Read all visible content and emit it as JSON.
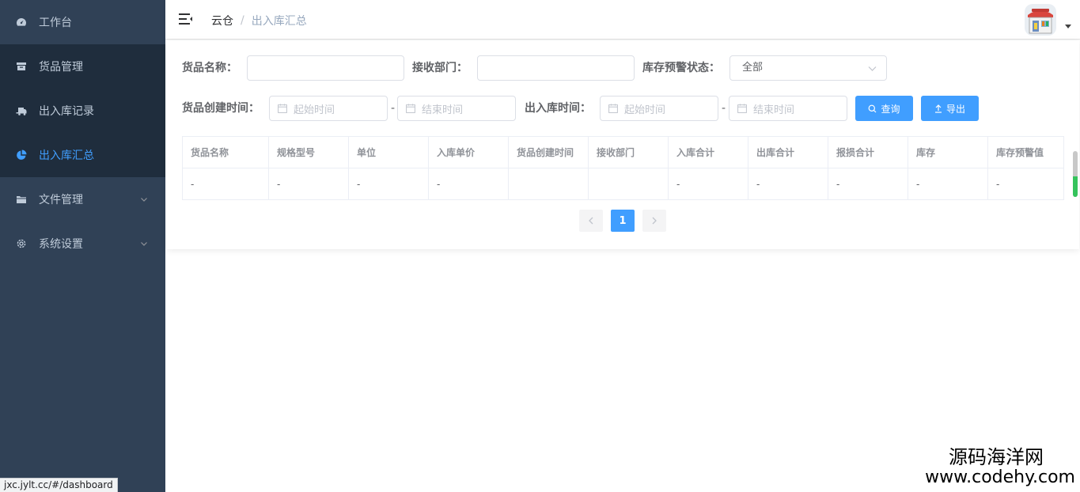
{
  "sidebar": {
    "items": [
      {
        "label": "工作台",
        "icon": "dashboard-icon"
      },
      {
        "label": "货品管理",
        "icon": "archive-icon"
      },
      {
        "label": "出入库记录",
        "icon": "truck-icon"
      },
      {
        "label": "出入库汇总",
        "icon": "pie-chart-icon"
      },
      {
        "label": "文件管理",
        "icon": "folder-icon"
      },
      {
        "label": "系统设置",
        "icon": "gear-icon"
      }
    ],
    "status_url": "jxc.jylt.cc/#/dashboard"
  },
  "header": {
    "breadcrumb_home": "云仓",
    "breadcrumb_sep": "/",
    "breadcrumb_current": "出入库汇总"
  },
  "form": {
    "goods_name_label": "货品名称：",
    "goods_name_value": "",
    "dept_label": "接收部门：",
    "dept_value": "",
    "warning_label": "库存预警状态：",
    "warning_selected": "全部",
    "created_label": "货品创建时间：",
    "created_start_ph": "起始时间",
    "created_end_ph": "结束时间",
    "inout_label": "出入库时间：",
    "inout_start_ph": "起始时间",
    "inout_end_ph": "结束时间",
    "range_sep": "-",
    "search_label": "查询",
    "export_label": "导出"
  },
  "table": {
    "columns": [
      "货品名称",
      "规格型号",
      "单位",
      "入库单价",
      "货品创建时间",
      "接收部门",
      "入库合计",
      "出库合计",
      "报损合计",
      "库存",
      "库存预警值"
    ],
    "rows": [
      [
        "-",
        "-",
        "-",
        "-",
        "",
        "",
        "-",
        "-",
        "-",
        "-",
        "-"
      ]
    ]
  },
  "pagination": {
    "current_page": "1"
  },
  "watermark": {
    "cn": "源码海洋网",
    "url": "www.codehy.com"
  },
  "colors": {
    "sidebar_bg": "#304156",
    "sidebar_active_bg": "#1f2d3d",
    "accent": "#409eff"
  }
}
